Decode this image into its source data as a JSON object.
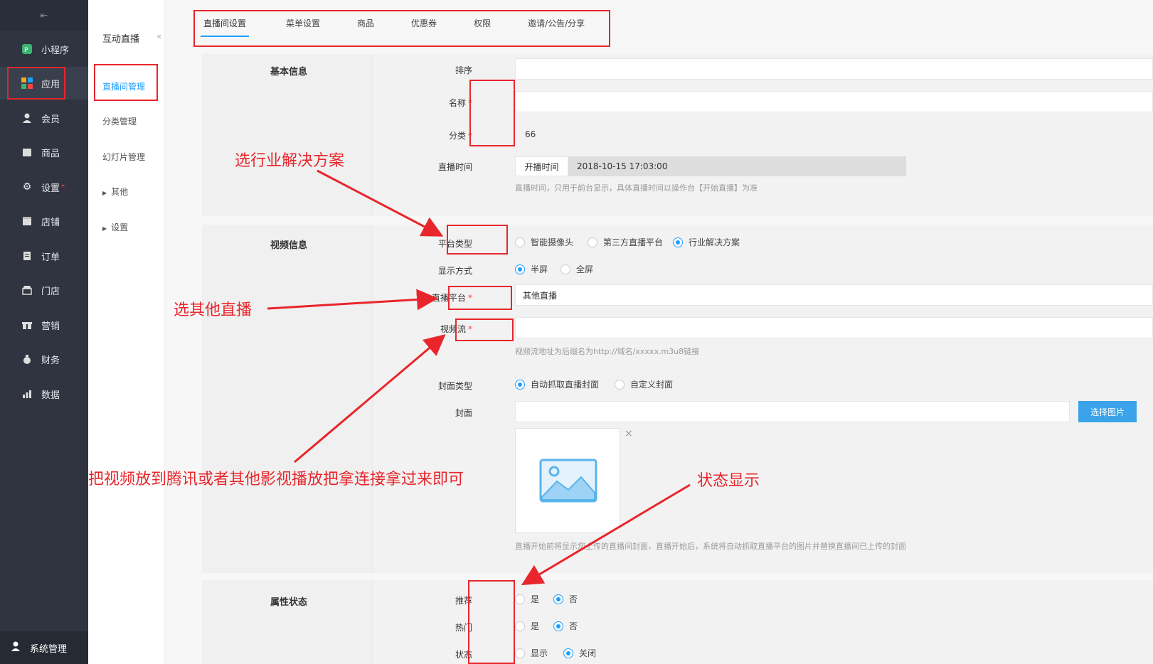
{
  "sidebar": {
    "items": [
      {
        "label": "小程序",
        "icon": "miniprogram-icon"
      },
      {
        "label": "应用",
        "icon": "apps-grid-icon"
      },
      {
        "label": "会员",
        "icon": "user-icon"
      },
      {
        "label": "商品",
        "icon": "product-icon"
      },
      {
        "label": "设置",
        "icon": "gear-icon"
      },
      {
        "label": "店铺",
        "icon": "store-icon"
      },
      {
        "label": "订单",
        "icon": "order-icon"
      },
      {
        "label": "门店",
        "icon": "shop-icon"
      },
      {
        "label": "营销",
        "icon": "gift-icon"
      },
      {
        "label": "财务",
        "icon": "money-bag-icon"
      },
      {
        "label": "数据",
        "icon": "chart-icon"
      }
    ],
    "settings_badge": "*",
    "system": "系统管理"
  },
  "subnav": {
    "header": "互动直播",
    "items": [
      "直播间管理",
      "分类管理",
      "幻灯片管理"
    ],
    "groups": [
      "其他",
      "设置"
    ]
  },
  "tabs": [
    "直播间设置",
    "菜单设置",
    "商品",
    "优惠券",
    "权限",
    "邀请/公告/分享"
  ],
  "basic": {
    "title": "基本信息",
    "sort_label": "排序",
    "name_label": "名称",
    "category_label": "分类",
    "category_value": "66",
    "live_time_label": "直播时间",
    "start_time_label": "开播时间",
    "start_time_value": "2018-10-15 17:03:00",
    "live_time_hint": "直播时间，只用于前台显示，具体直播时间以操作台【开始直播】为准"
  },
  "video": {
    "title": "视频信息",
    "platform_type_label": "平台类型",
    "platform_options": [
      "智能摄像头",
      "第三方直播平台",
      "行业解决方案"
    ],
    "display_label": "显示方式",
    "display_options": [
      "半屏",
      "全屏"
    ],
    "live_platform_label": "直播平台",
    "live_platform_value": "其他直播",
    "stream_label": "视频流",
    "stream_hint": "视频流地址为后缀名为http://域名/xxxxx.m3u8链接",
    "cover_type_label": "封面类型",
    "cover_options": [
      "自动抓取直播封面",
      "自定义封面"
    ],
    "cover_label": "封面",
    "choose_image": "选择图片",
    "close": "×",
    "cover_hint": "直播开始前将显示您上传的直播间封面，直播开始后，系统将自动抓取直播平台的图片并替换直播间已上传的封面"
  },
  "attrs": {
    "title": "属性状态",
    "recommend_label": "推荐",
    "hot_label": "热门",
    "status_label": "状态",
    "yes": "是",
    "no": "否",
    "show": "显示",
    "close": "关闭"
  },
  "annotations": {
    "a1": "选行业解决方案",
    "a2": "选其他直播",
    "a3": "把视频放到腾讯或者其他影视播放把拿连接拿过来即可",
    "a4": "状态显示"
  }
}
